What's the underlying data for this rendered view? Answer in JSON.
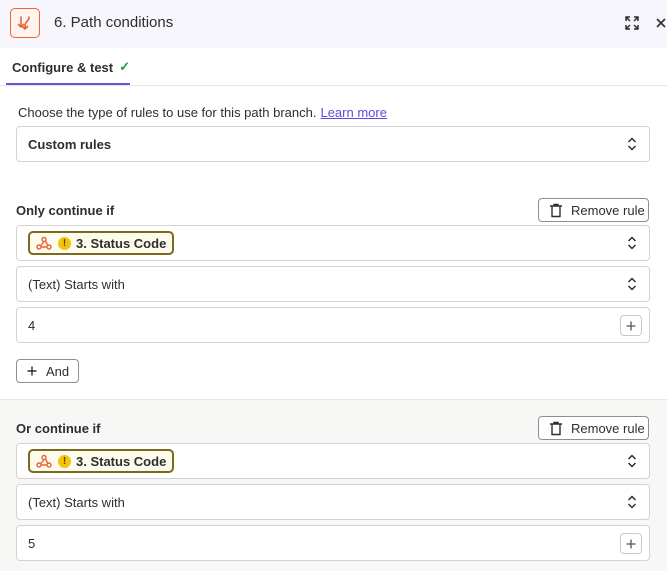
{
  "header": {
    "title": "6. Path conditions",
    "icons": [
      "paths-app-icon",
      "expand-icon",
      "close-icon"
    ]
  },
  "tabs": [
    {
      "label": "Configure & test",
      "check": "✓"
    }
  ],
  "description": {
    "text": "Choose the type of rules to use for this path branch.",
    "link": "Learn more"
  },
  "rule_type": {
    "value": "Custom rules"
  },
  "rules": [
    {
      "label": "Only continue if",
      "remove_label": "Remove rule",
      "field": {
        "value": "3. Status Code",
        "warning": "!"
      },
      "operator": "(Text) Starts with",
      "value": "4",
      "and_label": "And"
    },
    {
      "label": "Or continue if",
      "remove_label": "Remove rule",
      "field": {
        "value": "3. Status Code",
        "warning": "!"
      },
      "operator": "(Text) Starts with",
      "value": "5"
    }
  ],
  "colors": {
    "accent": "#6753dc",
    "brand_orange": "#e8643b",
    "success": "#1a9a4a",
    "link": "#5a4de0",
    "pill_border": "#7b6a1e",
    "warning": "#f1c40f"
  }
}
